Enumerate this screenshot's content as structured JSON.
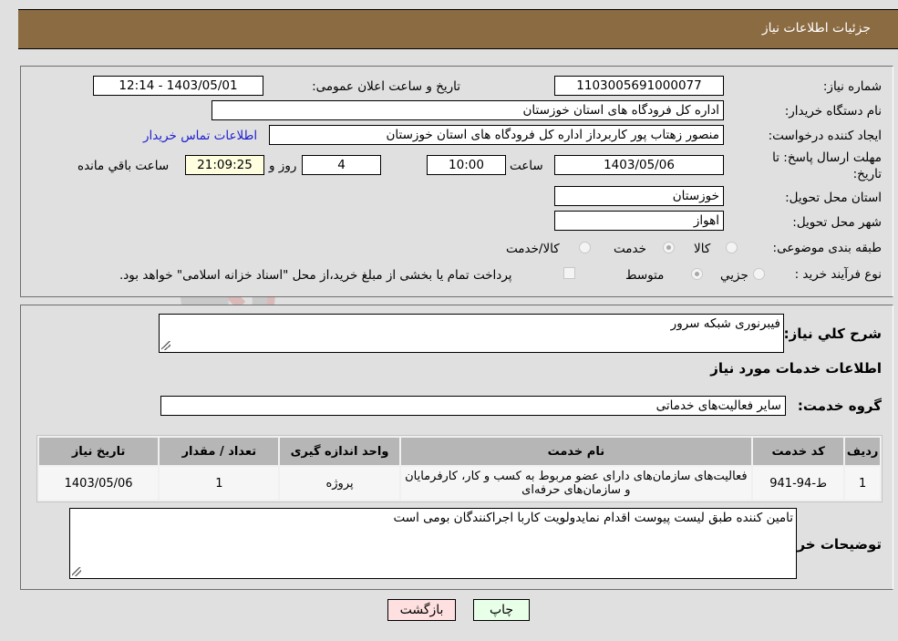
{
  "header": {
    "title": "جزئیات اطلاعات نیاز"
  },
  "details": {
    "need_number_label": "شماره نیاز:",
    "need_number": "1103005691000077",
    "announce_label": "تاریخ و ساعت اعلان عمومی:",
    "announce_value": "1403/05/01 - 12:14",
    "buyer_org_label": "نام دستگاه خریدار:",
    "buyer_org": "اداره کل فرودگاه های استان خوزستان",
    "creator_label": "ایجاد کننده درخواست:",
    "creator": "منصور زهتاب پور کاربرداز اداره کل فرودگاه های استان خوزستان",
    "contact_link": "اطلاعات تماس خریدار",
    "deadline_label_line1": "مهلت ارسال پاسخ: تا",
    "deadline_label_line2": "تاریخ:",
    "deadline_date": "1403/05/06",
    "time_label": "ساعت",
    "deadline_time": "10:00",
    "days_value": "4",
    "days_label": "روز و",
    "remaining_time": "21:09:25",
    "remaining_label": "ساعت باقي مانده",
    "province_label": "استان محل تحویل:",
    "province": "خوزستان",
    "city_label": "شهر محل تحویل:",
    "city": "اهواز",
    "category_label": "طبقه بندی موضوعی:",
    "category_options": [
      {
        "label": "کالا",
        "checked": false
      },
      {
        "label": "خدمت",
        "checked": true
      },
      {
        "label": "کالا/خدمت",
        "checked": false
      }
    ],
    "process_label": "نوع فرآیند خرید :",
    "process_options": [
      {
        "label": "جزيي",
        "checked": false
      },
      {
        "label": "متوسط",
        "checked": true
      }
    ],
    "treasury_note": "پرداخت تمام یا بخشی از مبلغ خرید،از محل \"اسناد خزانه اسلامی\" خواهد بود."
  },
  "summary": {
    "description_label": "شرح کلي نیاز:",
    "description": "فیبرنوری شبکه سرور",
    "services_heading": "اطلاعات خدمات مورد نیاز",
    "service_group_label": "گروه خدمت:",
    "service_group": "سایر فعالیت‌های خدماتی"
  },
  "table": {
    "headers": [
      "ردیف",
      "کد خدمت",
      "نام خدمت",
      "واحد اندازه گیری",
      "تعداد / مقدار",
      "تاریخ نیاز"
    ],
    "rows": [
      [
        "1",
        "ط-94-941",
        "فعالیت‌های سازمان‌های دارای عضو مربوط به کسب و کار، کارفرمایان و سازمان‌های حرفه‌ای",
        "پروژه",
        "1",
        "1403/05/06"
      ]
    ]
  },
  "buyer_notes": {
    "label": "توضیحات خریدار:",
    "text": "تامین کننده طبق لیست پیوست اقدام نمایدولویت کاربا اجراکنندگان بومی است"
  },
  "buttons": {
    "print": "چاپ",
    "back": "بازگشت"
  },
  "watermark": {
    "text": "AriaTender.neT"
  }
}
